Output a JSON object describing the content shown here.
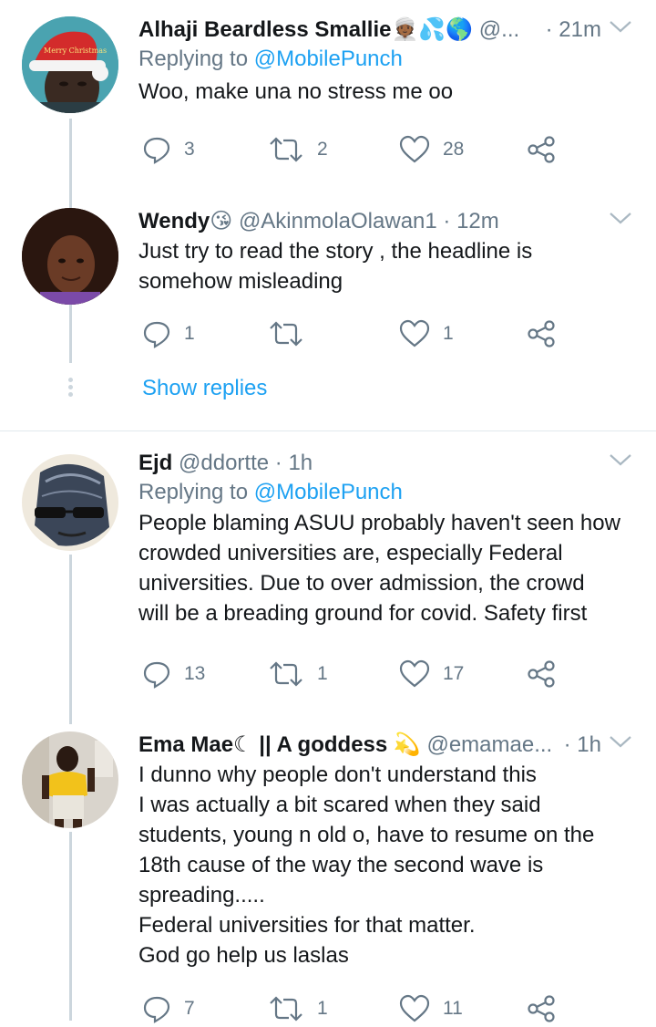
{
  "tweets": [
    {
      "name": "Alhaji Beardless Smallie",
      "emoji": "👳🏾💦🌎",
      "handle": "@...",
      "time": "· 21m",
      "reply_to_prefix": "Replying to ",
      "reply_to": "@MobilePunch",
      "text": "Woo, make una no stress me oo",
      "replies": "3",
      "retweets": "2",
      "likes": "28"
    },
    {
      "name": "Wendy",
      "emoji": "😘",
      "handle": "@AkinmolaOlawan1",
      "time": "· 12m",
      "text": "Just try to read the story , the headline is\nsomehow misleading",
      "replies": "1",
      "retweets": "",
      "likes": "1"
    },
    {
      "name": "Ejd",
      "emoji": "",
      "handle": "@ddortte",
      "time": "· 1h",
      "reply_to_prefix": "Replying to ",
      "reply_to": "@MobilePunch",
      "text": "People blaming ASUU probably haven't seen how\ncrowded universities are, especially Federal\nuniversities. Due to over admission, the crowd\nwill be a breading ground for covid. Safety first",
      "replies": "13",
      "retweets": "1",
      "likes": "17"
    },
    {
      "name": "Ema Mae☾ || A goddess",
      "emoji": "💫",
      "handle": "@emamae...",
      "time": "· 1h",
      "text": "I dunno why people don't understand this\nI was actually a bit scared when they said\nstudents, young n old o, have to resume on the\n18th cause of the way the second wave is\nspreading.....\nFederal universities for that matter.\nGod go help us laslas",
      "replies": "7",
      "retweets": "1",
      "likes": "11"
    }
  ],
  "show_replies": "Show replies",
  "avatar_texts": {
    "santa_hat": "Merry Christmas"
  },
  "colors": {
    "accent": "#1da1f2",
    "muted": "#657786",
    "text": "#14171a",
    "line": "#ccd6dd"
  },
  "icons": [
    "reply-icon",
    "retweet-icon",
    "like-icon",
    "share-icon",
    "chevron-down-icon"
  ]
}
